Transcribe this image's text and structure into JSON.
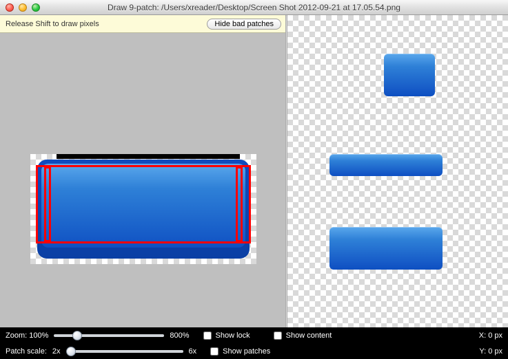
{
  "titlebar": {
    "title": "Draw 9-patch: /Users/xreader/Desktop/Screen Shot 2012-09-21 at 17.05.54.png"
  },
  "hintbar": {
    "hint": "Release Shift to draw pixels",
    "hide_btn": "Hide bad patches"
  },
  "bottombar": {
    "zoom_label": "Zoom:",
    "zoom_min_label": "100%",
    "zoom_max_label": "800%",
    "zoom_value": 18,
    "scale_label": "Patch scale:",
    "scale_min_label": "2x",
    "scale_max_label": "6x",
    "scale_value": 0,
    "show_lock_label": "Show lock",
    "show_lock": false,
    "show_content_label": "Show content",
    "show_content": false,
    "show_patches_label": "Show patches",
    "show_patches": false,
    "x_label": "X: 0 px",
    "y_label": "Y: 0 px"
  }
}
